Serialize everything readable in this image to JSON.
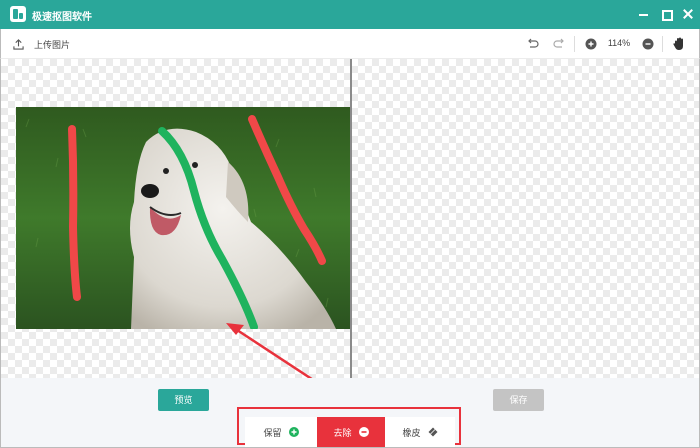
{
  "app": {
    "title": "极速抠图软件"
  },
  "toolbar": {
    "upload_label": "上传图片",
    "zoom": "114%"
  },
  "actions": {
    "preview_label": "预览",
    "save_label": "保存"
  },
  "tools": [
    {
      "label": "保留",
      "icon": "plus-circle-icon"
    },
    {
      "label": "去除",
      "icon": "minus-circle-icon"
    },
    {
      "label": "橡皮",
      "icon": "eraser-icon"
    }
  ],
  "colors": {
    "accent": "#2aa79a",
    "remove": "#e8323c",
    "keep_stroke": "#1fb35e",
    "remove_stroke": "#f04848"
  }
}
